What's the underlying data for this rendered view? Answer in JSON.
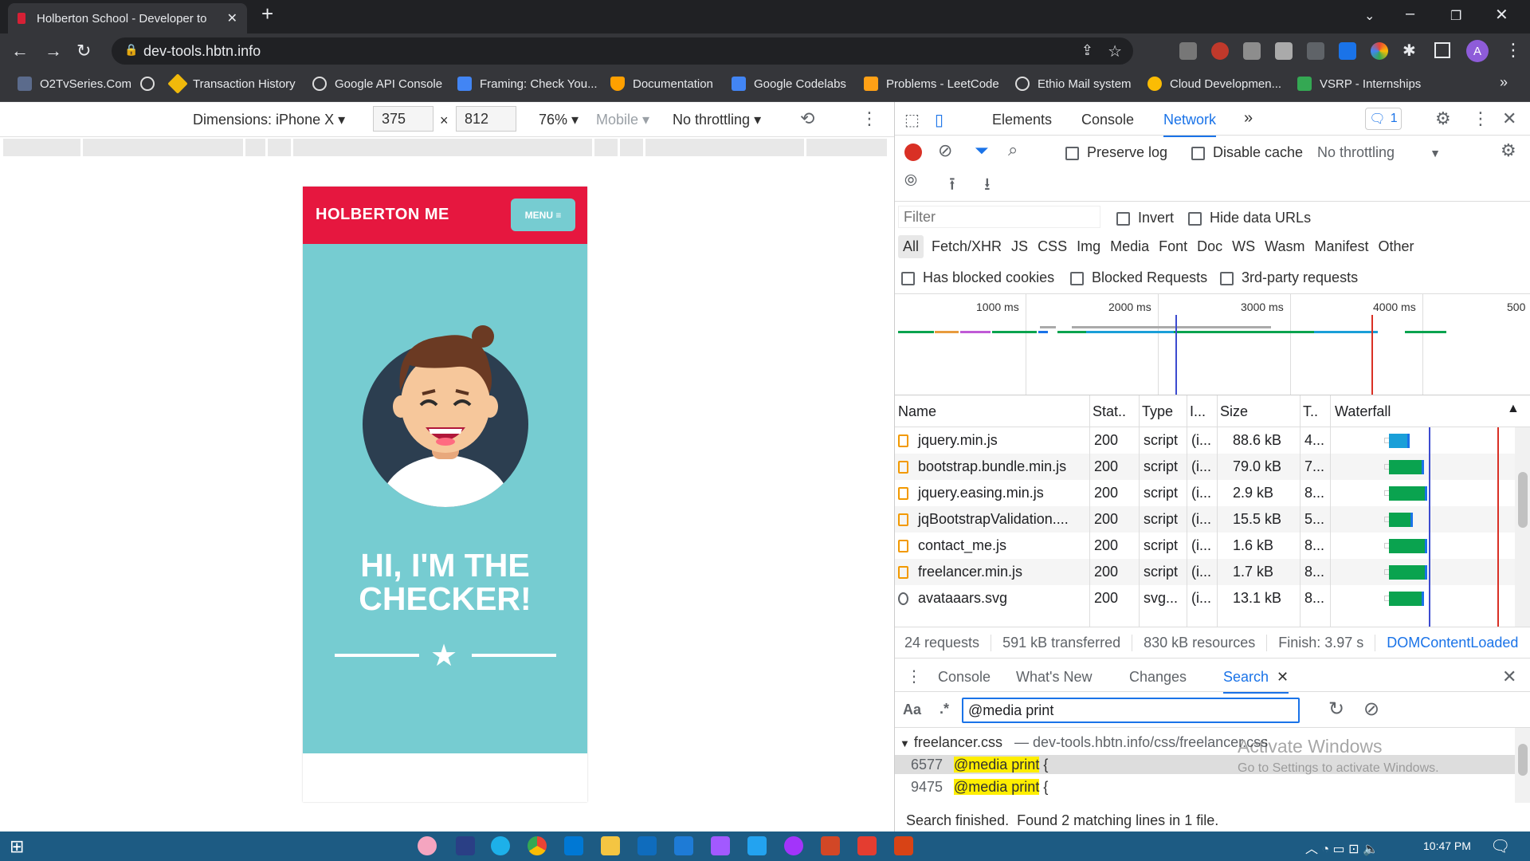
{
  "browser": {
    "tab_title": "Holberton School - Developer to",
    "new_tab": "+",
    "url": "dev-tools.hbtn.info",
    "bookmarks": [
      "O2TvSeries.Com",
      "Transaction History",
      "Google API Console",
      "Framing: Check You...",
      "Documentation",
      "Google Codelabs",
      "Problems - LeetCode",
      "Ethio Mail system",
      "Cloud Developmen...",
      "VSRP - Internships"
    ],
    "bookmarks_more": "»",
    "profile_initial": "A"
  },
  "device_toolbar": {
    "dimensions": "Dimensions: iPhone X",
    "width": "375",
    "times": "×",
    "height": "812",
    "zoom": "76%",
    "mode": "Mobile",
    "throttle": "No throttling"
  },
  "page": {
    "brand": "HOLBERTON ME",
    "menu": "MENU ≡",
    "headline_1": "HI, I'M THE",
    "headline_2": "CHECKER!"
  },
  "devtools": {
    "tabs": [
      "Elements",
      "Console",
      "Network"
    ],
    "more_tabs": "»",
    "issues_count": "1",
    "preserve_log": "Preserve log",
    "disable_cache": "Disable cache",
    "throttling": "No throttling",
    "filter_placeholder": "Filter",
    "invert": "Invert",
    "hide_data_urls": "Hide data URLs",
    "type_filters": [
      "All",
      "Fetch/XHR",
      "JS",
      "CSS",
      "Img",
      "Media",
      "Font",
      "Doc",
      "WS",
      "Wasm",
      "Manifest",
      "Other"
    ],
    "has_blocked_cookies": "Has blocked cookies",
    "blocked_requests": "Blocked Requests",
    "third_party": "3rd-party requests",
    "timeline_ticks": [
      "1000 ms",
      "2000 ms",
      "3000 ms",
      "4000 ms",
      "500"
    ],
    "columns": [
      "Name",
      "Stat..",
      "Type",
      "I...",
      "Size",
      "T..",
      "Waterfall"
    ],
    "rows": [
      {
        "name": "jquery.min.js",
        "status": "200",
        "type": "script",
        "init": "(i...",
        "size": "88.6 kB",
        "time": "4..."
      },
      {
        "name": "bootstrap.bundle.min.js",
        "status": "200",
        "type": "script",
        "init": "(i...",
        "size": "79.0 kB",
        "time": "7..."
      },
      {
        "name": "jquery.easing.min.js",
        "status": "200",
        "type": "script",
        "init": "(i...",
        "size": "2.9 kB",
        "time": "8..."
      },
      {
        "name": "jqBootstrapValidation....",
        "status": "200",
        "type": "script",
        "init": "(i...",
        "size": "15.5 kB",
        "time": "5..."
      },
      {
        "name": "contact_me.js",
        "status": "200",
        "type": "script",
        "init": "(i...",
        "size": "1.6 kB",
        "time": "8..."
      },
      {
        "name": "freelancer.min.js",
        "status": "200",
        "type": "script",
        "init": "(i...",
        "size": "1.7 kB",
        "time": "8..."
      },
      {
        "name": "avataaars.svg",
        "status": "200",
        "type": "svg...",
        "init": "(i...",
        "size": "13.1 kB",
        "time": "8..."
      }
    ],
    "summary": {
      "requests": "24 requests",
      "transferred": "591 kB transferred",
      "resources": "830 kB resources",
      "finish": "Finish: 3.97 s",
      "dcl": "DOMContentLoaded"
    },
    "drawer_tabs": [
      "Console",
      "What's New",
      "Changes",
      "Search"
    ],
    "search_aa": "Aa",
    "search_regex": ".*",
    "search_query": "@media print",
    "result_file": "freelancer.css",
    "result_path": "dev-tools.hbtn.info/css/freelancer.css",
    "results": [
      {
        "line": "6577",
        "match": "@media print",
        "rest": " {"
      },
      {
        "line": "9475",
        "match": "@media print",
        "rest": " {"
      }
    ],
    "search_status": "Search finished.  Found 2 matching lines in 1 file.",
    "watermark_1": "Activate Windows",
    "watermark_2": "Go to Settings to activate Windows."
  },
  "taskbar": {
    "time": "10:47 PM"
  }
}
